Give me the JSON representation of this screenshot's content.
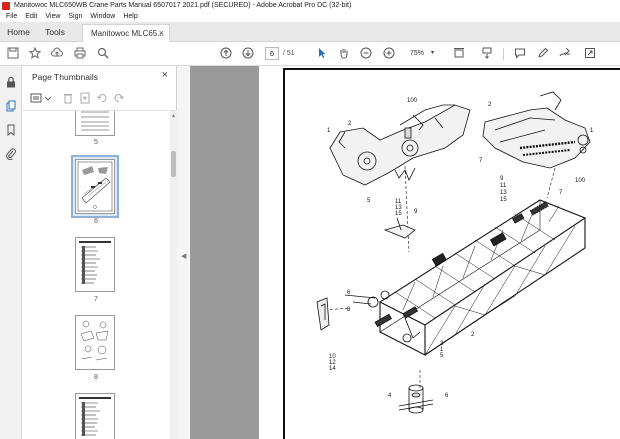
{
  "window": {
    "title": "Manitowoc MLC650WB Crane Parts Manual 6507017 2021.pdf (SECURED) - Adobe Acrobat Pro DC (32-bit)"
  },
  "menu": {
    "items": [
      "File",
      "Edit",
      "View",
      "Sign",
      "Window",
      "Help"
    ]
  },
  "tabs": {
    "home": "Home",
    "tools": "Tools",
    "document": "Manitowoc MLC65...",
    "close": "×"
  },
  "toolbar": {
    "current_page": "6",
    "total_pages": "/ 51",
    "zoom": "75%"
  },
  "thumbnails": {
    "title": "Page Thumbnails",
    "close": "×",
    "pages": [
      "5",
      "6",
      "7",
      "8"
    ],
    "selected_page": "6"
  },
  "drawing": {
    "callouts": [
      "100",
      "1",
      "2",
      "2",
      "1",
      "5",
      "7",
      "100",
      "9",
      "11",
      "13",
      "15",
      "7",
      "11",
      "13",
      "15",
      "9",
      "6",
      "8",
      "2",
      "3",
      "1",
      "5",
      "10",
      "12",
      "14",
      "4",
      "6"
    ]
  }
}
